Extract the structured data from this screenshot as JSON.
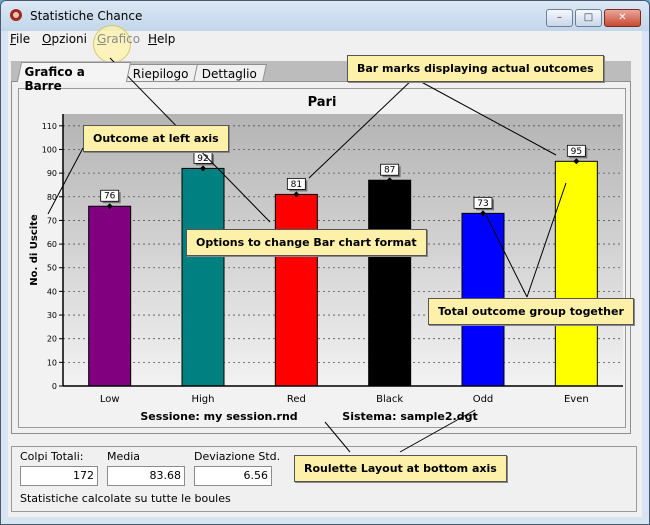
{
  "window": {
    "title": "Statistiche Chance"
  },
  "menu": [
    {
      "label": "File",
      "accel": "F",
      "rest": "ile",
      "disabled": false
    },
    {
      "label": "Opzioni",
      "accel": "O",
      "rest": "pzioni",
      "disabled": false
    },
    {
      "label": "Grafico",
      "accel": "G",
      "rest": "rafico",
      "disabled": true
    },
    {
      "label": "Help",
      "accel": "H",
      "rest": "elp",
      "disabled": false
    }
  ],
  "tabs": [
    {
      "label": "Grafico a Barre",
      "active": true
    },
    {
      "label": "Riepilogo",
      "active": false
    },
    {
      "label": "Dettaglio",
      "active": false
    }
  ],
  "chart_data": {
    "type": "bar",
    "title": "Pari",
    "xlabel": "",
    "ylabel": "No. di Uscite",
    "categories": [
      "Low",
      "High",
      "Red",
      "Black",
      "Odd",
      "Even"
    ],
    "values": [
      76,
      92,
      81,
      87,
      73,
      95
    ],
    "colors": [
      "#800080",
      "#008080",
      "#ff0000",
      "#000000",
      "#0000ff",
      "#ffff00"
    ],
    "ylim": [
      0,
      115
    ],
    "yticks": [
      0,
      10,
      20,
      30,
      40,
      50,
      60,
      70,
      80,
      90,
      100,
      110
    ],
    "grid": true,
    "footer_session": "Sessione: my session.rnd",
    "footer_system": "Sistema: sample2.dgt"
  },
  "stats": {
    "total_label": "Colpi Totali:",
    "total_value": "172",
    "mean_label": "Media",
    "mean_value": "83.68",
    "std_label": "Deviazione Std.",
    "std_value": "6.56",
    "note": "Statistiche calcolate su tutte le boules"
  },
  "callouts": {
    "bar_marks": "Bar marks displaying actual outcomes",
    "left_axis": "Outcome at left axis",
    "format_options": "Options to change Bar chart format",
    "total_group": "Total outcome group together",
    "bottom_axis": "Roulette Layout at bottom axis"
  }
}
